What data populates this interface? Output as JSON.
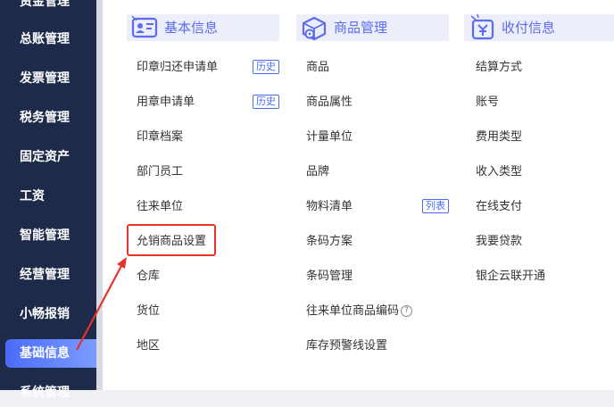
{
  "sidebar": {
    "items": [
      {
        "label": "资金管理"
      },
      {
        "label": "总账管理"
      },
      {
        "label": "发票管理"
      },
      {
        "label": "税务管理"
      },
      {
        "label": "固定资产"
      },
      {
        "label": "工资"
      },
      {
        "label": "智能管理"
      },
      {
        "label": "经营管理"
      },
      {
        "label": "小畅报销"
      },
      {
        "label": "基础信息",
        "active": true
      },
      {
        "label": "系统管理"
      }
    ]
  },
  "columns": [
    {
      "title": "基本信息",
      "icon": "id-card-icon",
      "items": [
        {
          "label": "印章归还申请单",
          "tag": "历史"
        },
        {
          "label": "用章申请单",
          "tag": "历史"
        },
        {
          "label": "印章档案"
        },
        {
          "label": "部门员工"
        },
        {
          "label": "往来单位"
        },
        {
          "label": "允销商品设置",
          "highlighted": true
        },
        {
          "label": "仓库"
        },
        {
          "label": "货位"
        },
        {
          "label": "地区"
        }
      ]
    },
    {
      "title": "商品管理",
      "icon": "box-gear-icon",
      "items": [
        {
          "label": "商品"
        },
        {
          "label": "商品属性"
        },
        {
          "label": "计量单位"
        },
        {
          "label": "品牌"
        },
        {
          "label": "物料清单",
          "tag": "列表"
        },
        {
          "label": "条码方案"
        },
        {
          "label": "条码管理"
        },
        {
          "label": "往来单位商品编码",
          "help": "?"
        },
        {
          "label": "库存预警线设置"
        }
      ]
    },
    {
      "title": "收付信息",
      "icon": "payment-icon",
      "items": [
        {
          "label": "结算方式"
        },
        {
          "label": "账号"
        },
        {
          "label": "费用类型"
        },
        {
          "label": "收入类型"
        },
        {
          "label": "在线支付"
        },
        {
          "label": "我要贷款"
        },
        {
          "label": "银企云联开通"
        }
      ]
    }
  ],
  "colors": {
    "sidebar_bg": "#1e2a4a",
    "accent": "#4a6cf7",
    "header_bg": "#eceef9",
    "annotation_red": "#e5332c"
  }
}
